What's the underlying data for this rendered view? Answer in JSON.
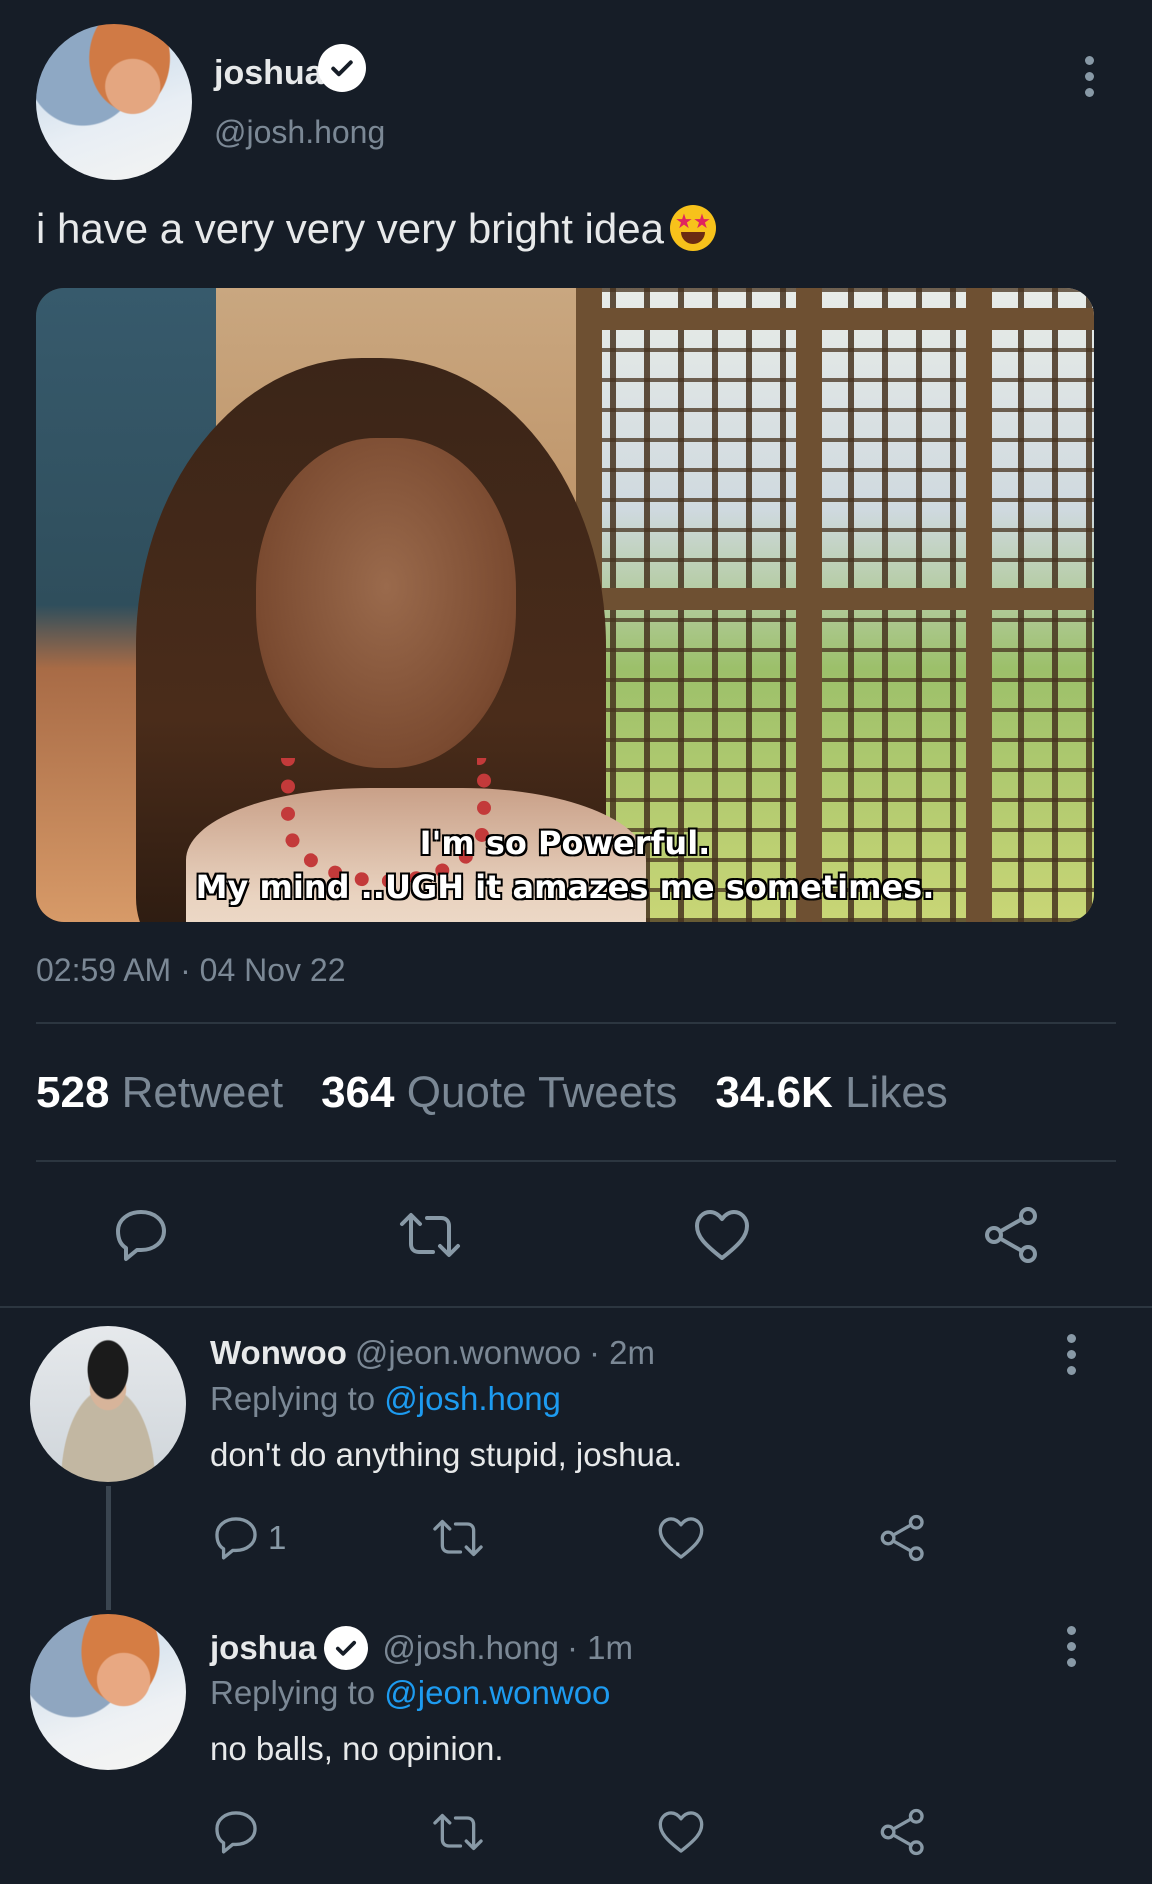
{
  "main_tweet": {
    "author_name": "joshua",
    "author_handle": "@josh.hong",
    "text": "i have a very very very bright idea",
    "media": {
      "caption_line1": "I'm so Powerful.",
      "caption_line2": "My mind ..UGH it amazes me sometimes."
    },
    "timestamp": "02:59 AM · 04 Nov 22",
    "stats": {
      "retweets_count": "528",
      "retweets_label": "Retweet",
      "quotes_count": "364",
      "quotes_label": "Quote Tweets",
      "likes_count": "34.6K",
      "likes_label": "Likes"
    }
  },
  "replies": [
    {
      "author_name": "Wonwoo",
      "author_handle": "@jeon.wonwoo",
      "time": "· 2m",
      "replying_prefix": "Replying to",
      "replying_to": "@josh.hong",
      "text": "don't do anything stupid, joshua.",
      "reply_count": "1"
    },
    {
      "author_name": "joshua",
      "author_handle": "@josh.hong",
      "time": "· 1m",
      "replying_prefix": "Replying to",
      "replying_to": "@jeon.wonwoo",
      "text": "no balls, no opinion."
    }
  ],
  "colors": {
    "background": "#161d27",
    "link": "#1d9bf0",
    "muted": "#7b8895"
  }
}
